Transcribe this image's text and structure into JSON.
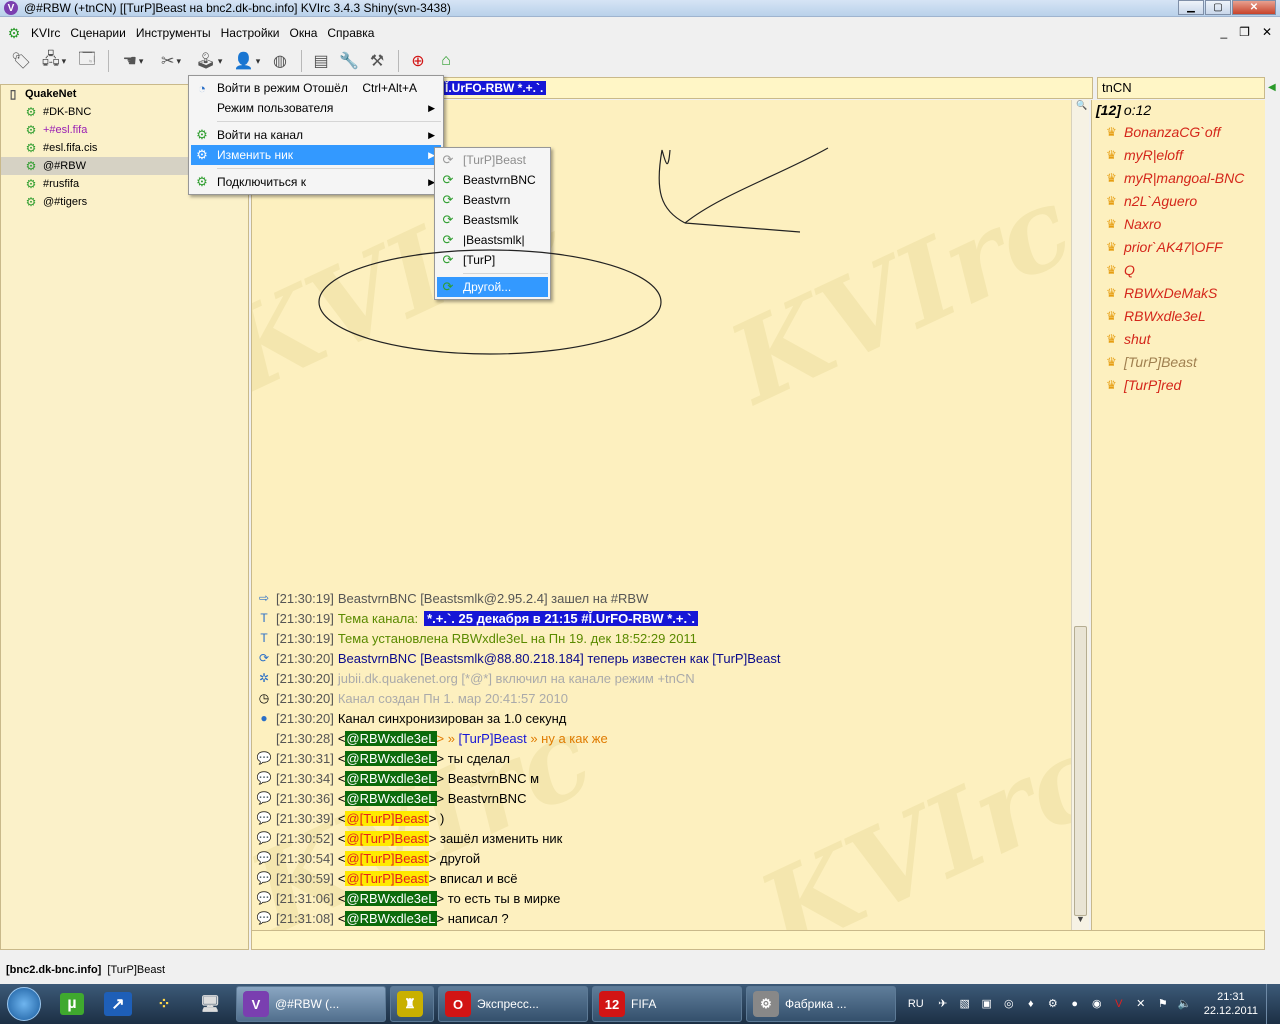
{
  "window": {
    "title": "@#RBW (+tnCN) [[TurP]Beast на bnc2.dk-bnc.info] KVIrc 3.4.3 Shiny(svn-3438)",
    "app_icon": "V"
  },
  "menubar": [
    "KVIrc",
    "Сценарии",
    "Инструменты",
    "Настройки",
    "Окна",
    "Справка"
  ],
  "tree": {
    "network": "QuakeNet",
    "channels": [
      {
        "label": "#DK-BNC",
        "color": "#000000"
      },
      {
        "label": "+#esl.fifa",
        "color": "#9a1fb3"
      },
      {
        "label": "#esl.fifa.cis",
        "color": "#000000"
      },
      {
        "label": "@#RBW",
        "color": "#000000",
        "selected": true
      },
      {
        "label": "#rusfifa",
        "color": "#000000"
      },
      {
        "label": "@#tigers",
        "color": "#000000"
      }
    ]
  },
  "topic_bar": {
    "text": "Ǐ.UrFO-RBW *.+.`."
  },
  "modes_box": {
    "text": "tnCN"
  },
  "userlist": {
    "count": "[12]",
    "ops": "o:12",
    "users": [
      {
        "nick": "BonanzaCG`off",
        "away": false
      },
      {
        "nick": "myR|eloff",
        "away": false
      },
      {
        "nick": "myR|mangoal-BNC",
        "away": false
      },
      {
        "nick": "n2L`Aguero",
        "away": false
      },
      {
        "nick": "Naxro",
        "away": false
      },
      {
        "nick": "prior`AK47|OFF",
        "away": false
      },
      {
        "nick": "Q",
        "away": false
      },
      {
        "nick": "RBWxDeMakS",
        "away": false
      },
      {
        "nick": "RBWxdle3eL",
        "away": false
      },
      {
        "nick": "shut",
        "away": false
      },
      {
        "nick": "[TurP]Beast",
        "away": true
      },
      {
        "nick": "[TurP]red",
        "away": false
      }
    ]
  },
  "messages": [
    {
      "ts": "[21:30:19]",
      "icon": "join-icon",
      "glyph": "⇨",
      "parts": [
        {
          "t": "BeastvrnBNC [Beastsmlk@2.95.2.4] зашел на #RBW",
          "c": "c-join"
        }
      ]
    },
    {
      "ts": "[21:30:19]",
      "icon": "topic-icon",
      "glyph": "T",
      "parts": [
        {
          "t": "Тема канала:",
          "c": "c-topic"
        },
        {
          "t": "*.+.`. 25 декабря в 21:15 #Ǐ.UrFO-RBW *.+.`.",
          "c": "topic-hl"
        }
      ]
    },
    {
      "ts": "[21:30:19]",
      "icon": "topic-icon",
      "glyph": "T",
      "parts": [
        {
          "t": "Тема установлена RBWxdle3eL на Пн 19. дек 18:52:29 2011",
          "c": "c-topic"
        }
      ]
    },
    {
      "ts": "[21:30:20]",
      "icon": "nick-change-icon",
      "glyph": "⟳",
      "parts": [
        {
          "t": "BeastvrnBNC [Beastsmlk@88.80.218.184] теперь известен как [TurP]Beast",
          "c": "c-nick"
        }
      ]
    },
    {
      "ts": "[21:30:20]",
      "icon": "mode-icon",
      "glyph": "✲",
      "parts": [
        {
          "t": "jubii.dk.quakenet.org [*@*] включил на канале режим +tnCN",
          "c": "c-gray"
        }
      ]
    },
    {
      "ts": "[21:30:20]",
      "icon": "clock-icon",
      "glyph": "◷",
      "parts": [
        {
          "t": "Канал создан Пн 1. мар 20:41:57 2010",
          "c": "c-gray"
        }
      ]
    },
    {
      "ts": "[21:30:20]",
      "icon": "sync-icon",
      "glyph": "●",
      "parts": [
        {
          "t": "Канал синхронизирован за 1.0 секунд",
          "c": "c-sync"
        }
      ]
    },
    {
      "ts": "[21:30:28]",
      "icon": "",
      "glyph": "",
      "parts": [
        {
          "t": "<",
          "c": ""
        },
        {
          "t": "@RBWxdle3eL",
          "c": "nick-g"
        },
        {
          "t": "> » ",
          "c": "hl-text"
        },
        {
          "t": "[TurP]Beast",
          "c": "hl-nick"
        },
        {
          "t": " » ну а как же",
          "c": "hl-text"
        }
      ]
    },
    {
      "ts": "[21:30:31]",
      "icon": "message-icon",
      "glyph": "💬",
      "bubble": "bubble-b",
      "parts": [
        {
          "t": "<",
          "c": ""
        },
        {
          "t": "@RBWxdle3eL",
          "c": "nick-g"
        },
        {
          "t": "> ты сделал",
          "c": ""
        }
      ]
    },
    {
      "ts": "[21:30:34]",
      "icon": "message-icon",
      "glyph": "💬",
      "bubble": "bubble-b",
      "parts": [
        {
          "t": "<",
          "c": ""
        },
        {
          "t": "@RBWxdle3eL",
          "c": "nick-g"
        },
        {
          "t": "> BeastvrnBNC м",
          "c": ""
        }
      ]
    },
    {
      "ts": "[21:30:36]",
      "icon": "message-icon",
      "glyph": "💬",
      "bubble": "bubble-b",
      "parts": [
        {
          "t": "<",
          "c": ""
        },
        {
          "t": "@RBWxdle3eL",
          "c": "nick-g"
        },
        {
          "t": "> BeastvrnBNC",
          "c": ""
        }
      ]
    },
    {
      "ts": "[21:30:39]",
      "icon": "own-message-icon",
      "glyph": "💬",
      "bubble": "bubble-g",
      "parts": [
        {
          "t": "<",
          "c": ""
        },
        {
          "t": "@[TurP]Beast",
          "c": "nick-y"
        },
        {
          "t": "> )",
          "c": ""
        }
      ]
    },
    {
      "ts": "[21:30:52]",
      "icon": "own-message-icon",
      "glyph": "💬",
      "bubble": "bubble-g",
      "parts": [
        {
          "t": "<",
          "c": ""
        },
        {
          "t": "@[TurP]Beast",
          "c": "nick-y"
        },
        {
          "t": "> зашёл изменить ник",
          "c": ""
        }
      ]
    },
    {
      "ts": "[21:30:54]",
      "icon": "own-message-icon",
      "glyph": "💬",
      "bubble": "bubble-g",
      "parts": [
        {
          "t": "<",
          "c": ""
        },
        {
          "t": "@[TurP]Beast",
          "c": "nick-y"
        },
        {
          "t": "> другой",
          "c": ""
        }
      ]
    },
    {
      "ts": "[21:30:59]",
      "icon": "own-message-icon",
      "glyph": "💬",
      "bubble": "bubble-g",
      "parts": [
        {
          "t": "<",
          "c": ""
        },
        {
          "t": "@[TurP]Beast",
          "c": "nick-y"
        },
        {
          "t": "> вписал и всё",
          "c": ""
        }
      ]
    },
    {
      "ts": "[21:31:06]",
      "icon": "message-icon",
      "glyph": "💬",
      "bubble": "bubble-b",
      "parts": [
        {
          "t": "<",
          "c": ""
        },
        {
          "t": "@RBWxdle3eL",
          "c": "nick-g"
        },
        {
          "t": "> то есть ты в мирке",
          "c": ""
        }
      ]
    },
    {
      "ts": "[21:31:08]",
      "icon": "message-icon",
      "glyph": "💬",
      "bubble": "bubble-b",
      "parts": [
        {
          "t": "<",
          "c": ""
        },
        {
          "t": "@RBWxdle3eL",
          "c": "nick-g"
        },
        {
          "t": "> написал ?",
          "c": ""
        }
      ]
    }
  ],
  "context_menu": {
    "items": [
      {
        "label": "Войти в режим Отошёл",
        "shortcut": "Ctrl+Alt+A",
        "submenu": false,
        "hot": false
      },
      {
        "label": "Режим пользователя",
        "shortcut": "",
        "submenu": true,
        "hot": false
      },
      {
        "sep": true
      },
      {
        "label": "Войти на канал",
        "shortcut": "",
        "submenu": true,
        "hot": false
      },
      {
        "label": "Изменить ник",
        "shortcut": "",
        "submenu": true,
        "hot": true
      },
      {
        "sep": true
      },
      {
        "label": "Подключиться к",
        "shortcut": "",
        "submenu": true,
        "hot": false
      }
    ]
  },
  "nick_submenu": {
    "items": [
      {
        "label": "[TurP]Beast",
        "disabled": true
      },
      {
        "label": "BeastvrnBNC"
      },
      {
        "label": "Beastvrn"
      },
      {
        "label": "Beastsmlk"
      },
      {
        "label": "|Beastsmlk|"
      },
      {
        "label": "[TurP]"
      },
      {
        "sep": true
      },
      {
        "label": "Другой...",
        "hot": true
      }
    ]
  },
  "statusbar": {
    "server": "[bnc2.dk-bnc.info]",
    "nick": "[TurP]Beast"
  },
  "watermark": "KVIrc",
  "taskbar": {
    "buttons": [
      {
        "label": "@#RBW (...",
        "icon": "V",
        "icon_color": "#7a3fb0",
        "active": true
      },
      {
        "label": "",
        "icon": "♜",
        "icon_color": "#c9b000",
        "active": false
      },
      {
        "label": "Экспресс...",
        "icon": "O",
        "icon_color": "#d21414",
        "active": false
      },
      {
        "label": "FIFA",
        "icon": "12",
        "icon_color": "#d21414",
        "active": false
      },
      {
        "label": "Фабрика ...",
        "icon": "⚙",
        "icon_color": "#888888",
        "active": false
      }
    ],
    "lang": "RU",
    "time": "21:31",
    "date": "22.12.2011"
  }
}
